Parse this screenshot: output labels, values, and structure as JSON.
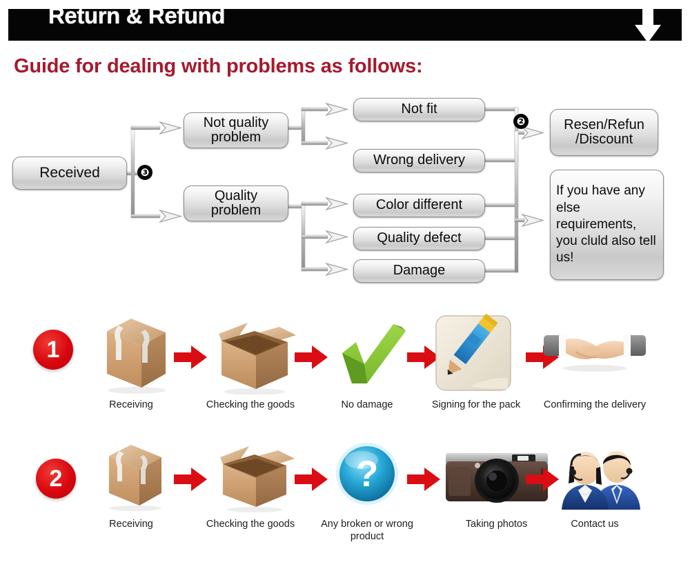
{
  "header": {
    "title": "Return & Refund",
    "arrow_icon": "down-arrow-icon",
    "bar_color": "#050505"
  },
  "guide": {
    "title": "Guide for dealing with problems as follows:",
    "color": "#a6192e"
  },
  "flowchart": {
    "nodes": {
      "received": "Received",
      "not_quality_problem": "Not quality\nproblem",
      "quality_problem": "Quality\nproblem",
      "not_fit": "Not fit",
      "wrong_delivery": "Wrong delivery",
      "color_different": "Color different",
      "quality_defect": "Quality defect",
      "damage": "Damage",
      "resend_refund": "Resen/Refun\n/Discount",
      "else_requirements": "If you have any else requirements, you cluld also tell us!"
    },
    "badges": {
      "badge_three": "❸",
      "badge_two": "❷"
    }
  },
  "steps": {
    "row1": {
      "number": "1",
      "items": [
        {
          "icon": "sealed-box-icon",
          "caption": "Receiving"
        },
        {
          "icon": "open-box-icon",
          "caption": "Checking the goods"
        },
        {
          "icon": "green-check-icon",
          "caption": "No damage"
        },
        {
          "icon": "pencil-sign-icon",
          "caption": "Signing for the pack"
        },
        {
          "icon": "handshake-icon",
          "caption": "Confirming the delivery"
        }
      ]
    },
    "row2": {
      "number": "2",
      "items": [
        {
          "icon": "sealed-box-icon",
          "caption": "Receiving"
        },
        {
          "icon": "open-box-icon",
          "caption": "Checking the goods"
        },
        {
          "icon": "question-mark-icon",
          "caption": "Any broken or wrong product"
        },
        {
          "icon": "camera-icon",
          "caption": "Taking photos"
        },
        {
          "icon": "support-agents-icon",
          "caption": "Contact us"
        }
      ]
    },
    "arrow_icon": "red-right-arrow-icon",
    "arrow_color": "#d90d13"
  }
}
